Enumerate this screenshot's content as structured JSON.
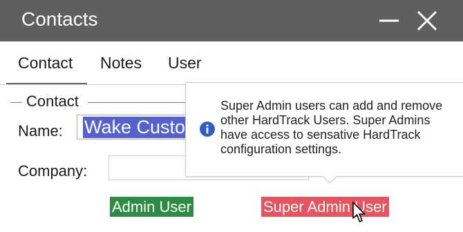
{
  "window": {
    "title": "Contacts",
    "minimize_icon": "minimize-icon",
    "close_icon": "close-icon"
  },
  "tabs": [
    {
      "label": "Contact",
      "active": true
    },
    {
      "label": "Notes",
      "active": false
    },
    {
      "label": "User",
      "active": false
    }
  ],
  "contact_section": {
    "legend": "Contact",
    "name_label": "Name:",
    "name_value": "Wake Custo",
    "company_label": "Company:",
    "company_value": ""
  },
  "user_roles": {
    "admin_label": "Admin User",
    "super_admin_label": "Super Admin User"
  },
  "tooltip": {
    "icon": "info-icon",
    "lines": [
      "Super Admin users can add and remove",
      "other HardTrack Users. Super Admins",
      "have access to sensative HardTrack",
      "configuration settings."
    ]
  },
  "colors": {
    "titlebar": "#5f5f5f",
    "selection": "#5561cf",
    "admin_chip": "#2e8b46",
    "super_admin_chip": "#e85360",
    "info_icon": "#2f5fc4"
  }
}
